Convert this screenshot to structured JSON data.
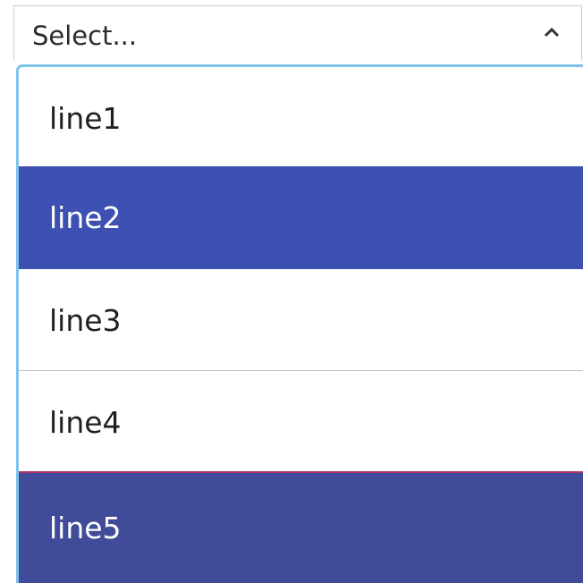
{
  "select": {
    "placeholder": "Select...",
    "toggle_icon": "chevron-up-icon",
    "options": [
      {
        "label": "line1",
        "state": "default"
      },
      {
        "label": "line2",
        "state": "highlighted"
      },
      {
        "label": "line3",
        "state": "default"
      },
      {
        "label": "line4",
        "state": "default"
      },
      {
        "label": "line5",
        "state": "selected"
      }
    ]
  },
  "colors": {
    "highlight": "#3d51b2",
    "selected": "#404c99",
    "focus_border": "#80c2ea",
    "selected_top_border": "#b2306a"
  }
}
